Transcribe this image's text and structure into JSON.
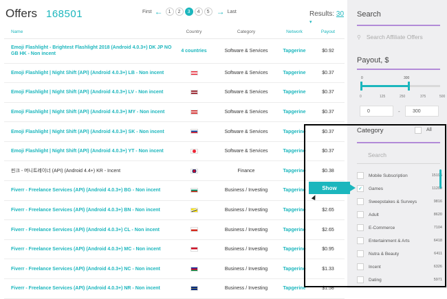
{
  "header": {
    "title": "Offers",
    "count": "168501"
  },
  "pagination": {
    "first": "First",
    "prev_icon": "arrow-left",
    "pages": [
      "1",
      "2",
      "3",
      "4",
      "5"
    ],
    "active": "3",
    "next_icon": "arrow-right",
    "last": "Last"
  },
  "results": {
    "label": "Results:",
    "value": "30"
  },
  "table": {
    "columns": [
      "Name",
      "Country",
      "Category",
      "Network",
      "Payout"
    ],
    "rows": [
      {
        "name": "Emoji Flashlight - Brightest Flashlight 2018 (Android 4.0.3+) DK JP NO GB HK - Non incent",
        "country": "4 countries",
        "category": "Software & Services",
        "network": "Tapgerine",
        "payout": "$0.92"
      },
      {
        "name": "Emoji Flashlight | Night Shift (API) (Android 4.0.3+) LB - Non incent",
        "flag": "lb",
        "category": "Software & Services",
        "network": "Tapgerine",
        "payout": "$0.37"
      },
      {
        "name": "Emoji Flashlight | Night Shift (API) (Android 4.0.3+) LV - Non incent",
        "flag": "lv",
        "category": "Software & Services",
        "network": "Tapgerine",
        "payout": "$0.37"
      },
      {
        "name": "Emoji Flashlight | Night Shift (API) (Android 4.0.3+) MY - Non incent",
        "flag": "my",
        "category": "Software & Services",
        "network": "Tapgerine",
        "payout": "$0.37"
      },
      {
        "name": "Emoji Flashlight | Night Shift (API) (Android 4.0.3+) SK - Non incent",
        "flag": "sk",
        "category": "Software & Services",
        "network": "Tapgerine",
        "payout": "$0.37"
      },
      {
        "name": "Emoji Flashlight | Night Shift (API) (Android 4.0.3+) YT - Non incent",
        "flag": "yt",
        "category": "Software & Services",
        "network": "Tapgerine",
        "payout": "$0.37"
      },
      {
        "name": "핀크 - 머니트레이너 (API) (Android 4.4+) KR - Incent",
        "flag": "kr",
        "category": "Finance",
        "network": "Tapgerine",
        "payout": "$0.38"
      },
      {
        "name": "Fiverr - Freelance Services (API) (Android 4.0.3+) BG - Non incent",
        "flag": "bg",
        "category": "Business / Investing",
        "network": "Tapgerine",
        "payout": ""
      },
      {
        "name": "Fiverr - Freelance Services (API) (Android 4.0.3+) BN - Non incent",
        "flag": "bn",
        "category": "Business / Investing",
        "network": "Tapgerine",
        "payout": "$2.65"
      },
      {
        "name": "Fiverr - Freelance Services (API) (Android 4.0.3+) CL - Non incent",
        "flag": "cl",
        "category": "Business / Investing",
        "network": "Tapgerine",
        "payout": "$2.65"
      },
      {
        "name": "Fiverr - Freelance Services (API) (Android 4.0.3+) MC - Non incent",
        "flag": "mc",
        "category": "Business / Investing",
        "network": "Tapgerine",
        "payout": "$0.95"
      },
      {
        "name": "Fiverr - Freelance Services (API) (Android 4.0.3+) NC - Non incent",
        "flag": "nc",
        "category": "Business / Investing",
        "network": "Tapgerine",
        "payout": "$1.33"
      },
      {
        "name": "Fiverr - Freelance Services (API) (Android 4.0.3+) NR - Non incent",
        "flag": "nr",
        "category": "Business / Investing",
        "network": "Tapgerine",
        "payout": "$1.58"
      }
    ]
  },
  "sidebar": {
    "search_title": "Search",
    "search_placeholder": "Search Affiliate Offers",
    "payout_title": "Payout, $",
    "slider": {
      "min_label": "0",
      "max_label": "300",
      "ticks": [
        "0",
        "125",
        "250",
        "375",
        "500"
      ],
      "from": 0,
      "to": 300,
      "scale_max": 500
    },
    "range_from": "0",
    "range_to": "300",
    "category_title": "Category",
    "all_label": "All",
    "category_search": "Search",
    "categories": [
      {
        "label": "Mobile Subscription",
        "count": "15195",
        "checked": false
      },
      {
        "label": "Games",
        "count": "11209",
        "checked": true
      },
      {
        "label": "Sweepstakes & Surveys",
        "count": "9816",
        "checked": false
      },
      {
        "label": "Adult",
        "count": "8620",
        "checked": false
      },
      {
        "label": "E-Commerce",
        "count": "7104",
        "checked": false
      },
      {
        "label": "Entertainment & Arts",
        "count": "6418",
        "checked": false
      },
      {
        "label": "Nutra & Beauty",
        "count": "6411",
        "checked": false
      },
      {
        "label": "Incent",
        "count": "6326",
        "checked": false
      },
      {
        "label": "Dating",
        "count": "5971",
        "checked": false
      }
    ],
    "show_button": "Show"
  },
  "colors": {
    "accent": "#1bb6bd",
    "divider": "#b28ad8",
    "sidebar_bg": "#efeff1"
  }
}
